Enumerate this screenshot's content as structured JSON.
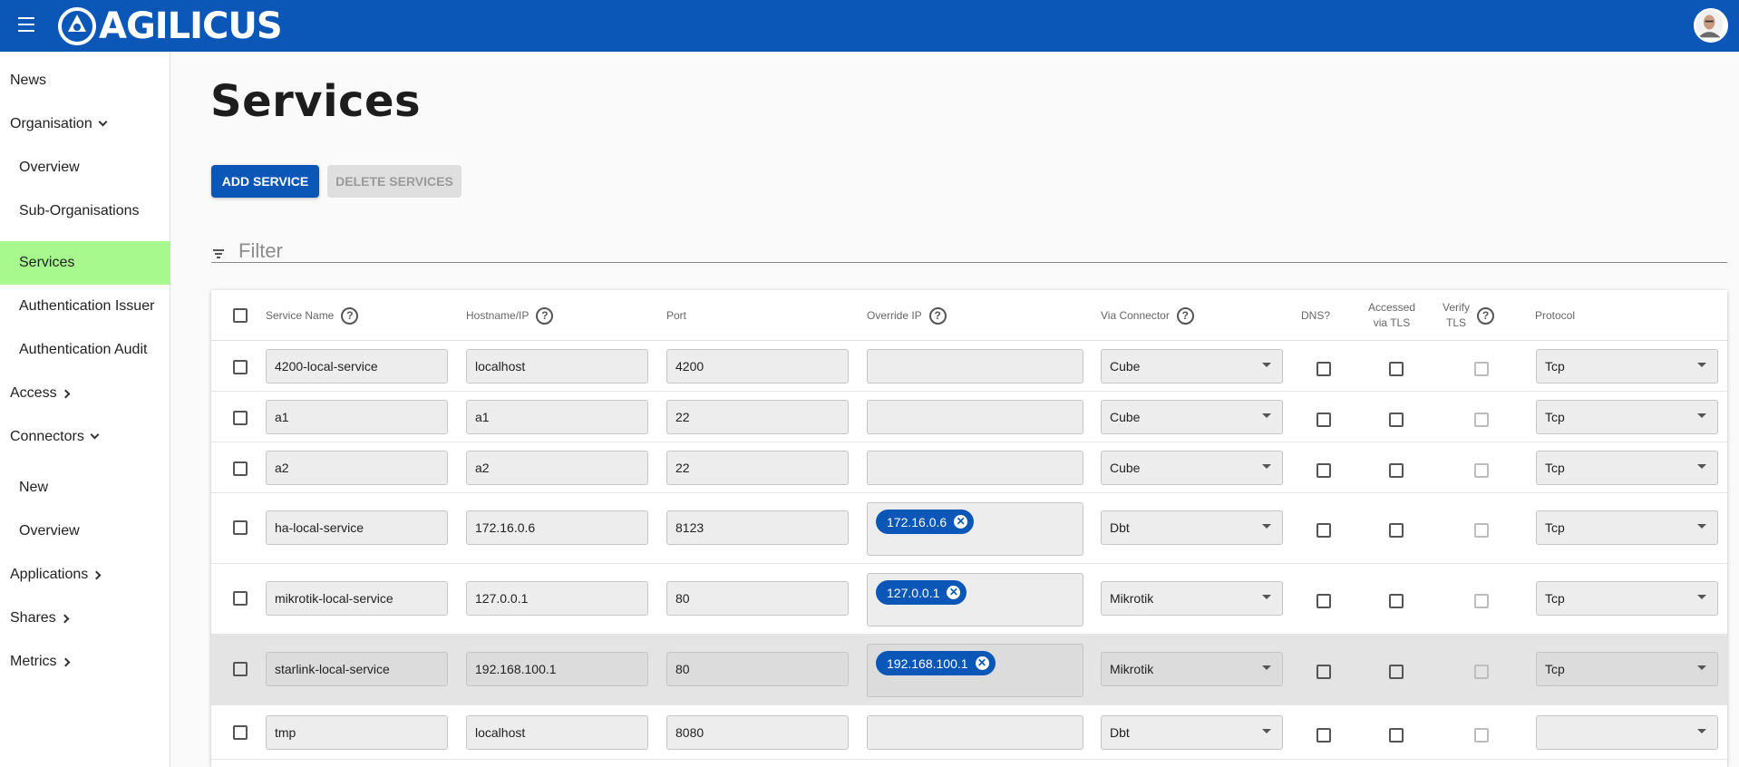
{
  "header": {
    "brand": "AGILICUS"
  },
  "sidebar": {
    "items": [
      {
        "label": "News"
      },
      {
        "label": "Organisation"
      },
      {
        "label": "Overview"
      },
      {
        "label": "Sub-Organisations"
      },
      {
        "label": "Services"
      },
      {
        "label": "Authentication Issuer"
      },
      {
        "label": "Authentication Audit"
      },
      {
        "label": "Access"
      },
      {
        "label": "Connectors"
      },
      {
        "label": "New"
      },
      {
        "label": "Overview"
      },
      {
        "label": "Applications"
      },
      {
        "label": "Shares"
      },
      {
        "label": "Metrics"
      }
    ]
  },
  "page": {
    "title": "Services",
    "add_label": "ADD SERVICE",
    "delete_label": "DELETE SERVICES",
    "filter_placeholder": "Filter"
  },
  "table": {
    "headers": {
      "service_name": "Service Name",
      "hostname": "Hostname/IP",
      "port": "Port",
      "override_ip": "Override IP",
      "via_connector": "Via Connector",
      "dns": "DNS?",
      "accessed_tls_1": "Accessed",
      "accessed_tls_2": "via TLS",
      "verify_tls_1": "Verify",
      "verify_tls_2": "TLS",
      "protocol": "Protocol"
    },
    "rows": [
      {
        "name": "4200-local-service",
        "host": "localhost",
        "port": "4200",
        "override": "",
        "connector": "Cube",
        "protocol": "Tcp"
      },
      {
        "name": "a1",
        "host": "a1",
        "port": "22",
        "override": "",
        "connector": "Cube",
        "protocol": "Tcp"
      },
      {
        "name": "a2",
        "host": "a2",
        "port": "22",
        "override": "",
        "connector": "Cube",
        "protocol": "Tcp"
      },
      {
        "name": "ha-local-service",
        "host": "172.16.0.6",
        "port": "8123",
        "override": "172.16.0.6",
        "connector": "Dbt",
        "protocol": "Tcp"
      },
      {
        "name": "mikrotik-local-service",
        "host": "127.0.0.1",
        "port": "80",
        "override": "127.0.0.1",
        "connector": "Mikrotik",
        "protocol": "Tcp"
      },
      {
        "name": "starlink-local-service",
        "host": "192.168.100.1",
        "port": "80",
        "override": "192.168.100.1",
        "connector": "Mikrotik",
        "protocol": "Tcp"
      },
      {
        "name": "tmp",
        "host": "localhost",
        "port": "8080",
        "override": "",
        "connector": "Dbt",
        "protocol": ""
      }
    ]
  }
}
